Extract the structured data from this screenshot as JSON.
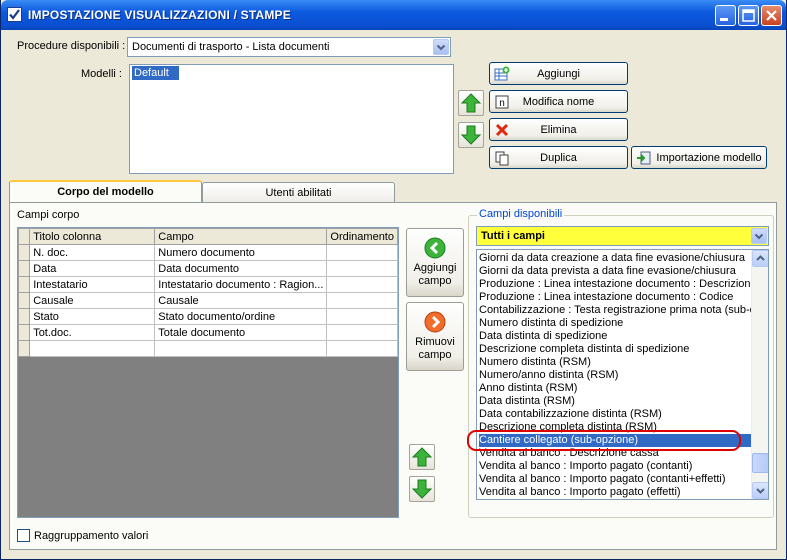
{
  "window": {
    "title": "IMPOSTAZIONE VISUALIZZAZIONI / STAMPE"
  },
  "procedure": {
    "label": "Procedure disponibili :",
    "value": "Documenti di trasporto - Lista documenti"
  },
  "models": {
    "label": "Modelli :",
    "items": [
      "Default"
    ],
    "selected": "Default"
  },
  "buttons": {
    "add": "Aggiungi",
    "rename": "Modifica nome",
    "delete": "Elimina",
    "duplicate": "Duplica",
    "import": "Importazione modello"
  },
  "tabs": [
    {
      "label": "Corpo del modello",
      "active": true
    },
    {
      "label": "Utenti abilitati",
      "active": false
    }
  ],
  "body_fields": {
    "label": "Campi corpo",
    "columns": [
      "Titolo colonna",
      "Campo",
      "Ordinamento"
    ],
    "rows": [
      [
        "N. doc.",
        "Numero documento",
        ""
      ],
      [
        "Data",
        "Data documento",
        ""
      ],
      [
        "Intestatario",
        "Intestatario documento : Ragion...",
        ""
      ],
      [
        "Causale",
        "Causale",
        ""
      ],
      [
        "Stato",
        "Stato documento/ordine",
        ""
      ],
      [
        "Tot.doc.",
        "Totale documento",
        ""
      ],
      [
        "",
        "",
        ""
      ]
    ]
  },
  "side_buttons": {
    "add_field": "Aggiungi campo",
    "remove_field": "Rimuovi campo"
  },
  "available_fields": {
    "label": "Campi disponibili",
    "filter": "Tutti i campi",
    "items": [
      "Giorni da data creazione a data fine evasione/chiusura",
      "Giorni da data prevista a data fine evasione/chiusura",
      "Produzione : Linea intestazione documento : Descrizione",
      "Produzione : Linea intestazione documento : Codice",
      "Contabilizzazione : Testa registrazione prima nota (sub-opz",
      "Numero distinta di spedizione",
      "Data distinta di spedizione",
      "Descrizione completa distinta di spedizione",
      "Numero distinta (RSM)",
      "Numero/anno distinta (RSM)",
      "Anno distinta (RSM)",
      "Data distinta (RSM)",
      "Data contabilizzazione distinta (RSM)",
      "Descrizione completa distinta (RSM)",
      "Cantiere collegato (sub-opzione)",
      "Vendita al banco : Descrizione cassa",
      "Vendita al banco : Importo pagato (contanti)",
      "Vendita al banco : Importo pagato (contanti+effetti)",
      "Vendita al banco : Importo pagato (effetti)"
    ],
    "selected_index": 14
  },
  "grouping": {
    "label": "Raggruppamento valori",
    "checked": false
  }
}
